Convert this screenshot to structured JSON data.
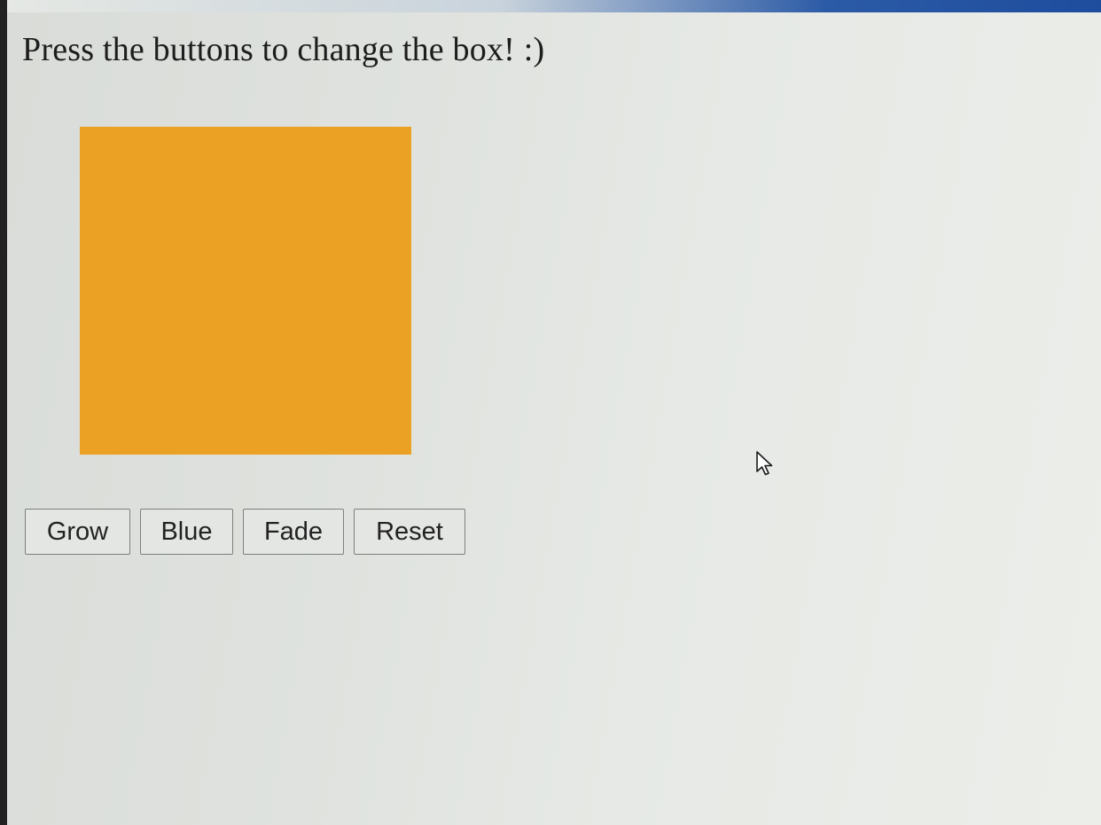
{
  "page": {
    "heading": "Press the buttons to change the box! :)"
  },
  "box": {
    "color": "#eba224"
  },
  "buttons": {
    "grow_label": "Grow",
    "blue_label": "Blue",
    "fade_label": "Fade",
    "reset_label": "Reset"
  },
  "cursor": {
    "icon": "pointer-cursor-icon"
  }
}
